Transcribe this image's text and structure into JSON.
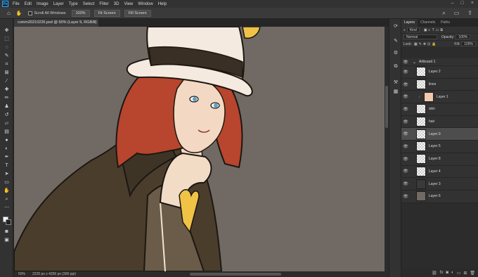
{
  "menu": {
    "logo": "Ps",
    "items": [
      "File",
      "Edit",
      "Image",
      "Layer",
      "Type",
      "Select",
      "Filter",
      "3D",
      "View",
      "Window",
      "Help"
    ],
    "right_icons": [
      "search-icon",
      "layout-icon",
      "share-icon"
    ]
  },
  "options": {
    "scroll_all_label": "Scroll All Windows",
    "zoom_value": "100%",
    "fit_screen_label": "Fit Screen",
    "fill_screen_label": "Fill Screen"
  },
  "document": {
    "tab_title": "comm20210226.psd @ 50% (Layer 9, RGB/8)",
    "close_glyph": "×"
  },
  "status": {
    "zoom": "50%",
    "doc_info": "2225 px x 4256 px (300 ppi)"
  },
  "panel": {
    "tabs": [
      "Layers",
      "Channels",
      "Paths"
    ],
    "kind_label": "Kind",
    "blend_mode": "Normal",
    "opacity_label": "Opacity:",
    "opacity_value": "100%",
    "lock_label": "Lock:",
    "fill_label": "Fill:",
    "fill_value": "100%"
  },
  "layers": [
    {
      "name": "Artboard 1",
      "type": "group"
    },
    {
      "name": "Layer 2",
      "type": "layer"
    },
    {
      "name": "lines",
      "type": "layer"
    },
    {
      "name": "Layer 1",
      "type": "layer",
      "clipped": true
    },
    {
      "name": "skin",
      "type": "layer"
    },
    {
      "name": "hair",
      "type": "layer"
    },
    {
      "name": "Layer 9",
      "type": "layer",
      "selected": true
    },
    {
      "name": "Layer 5",
      "type": "layer"
    },
    {
      "name": "Layer 8",
      "type": "layer"
    },
    {
      "name": "Layer 4",
      "type": "layer"
    },
    {
      "name": "Layer 3",
      "type": "layer"
    },
    {
      "name": "Layer 6",
      "type": "layer"
    }
  ],
  "colors": {
    "canvas_bg": "#716a64",
    "hair": "#b8452e",
    "skin": "#f3d8c3",
    "hat": "#f4eadf",
    "coat": "#4a3d2c",
    "accent": "#f0c346"
  }
}
